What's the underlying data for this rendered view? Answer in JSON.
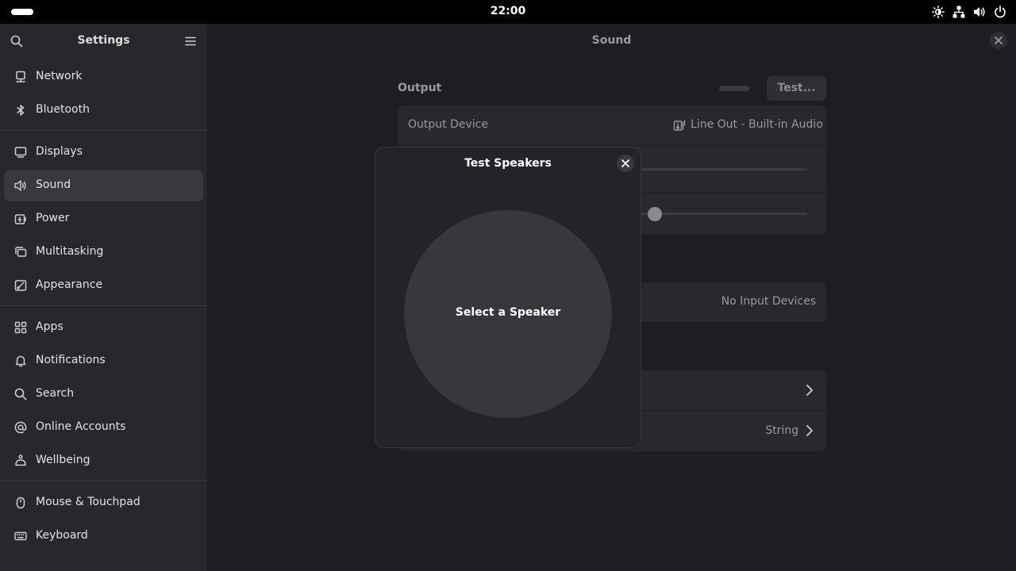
{
  "topbar": {
    "time": "22:00"
  },
  "sidebar": {
    "title": "Settings",
    "groups": [
      [
        {
          "label": "Network",
          "icon": "network-icon"
        },
        {
          "label": "Bluetooth",
          "icon": "bluetooth-icon"
        }
      ],
      [
        {
          "label": "Displays",
          "icon": "display-icon"
        },
        {
          "label": "Sound",
          "icon": "sound-icon",
          "active": true
        },
        {
          "label": "Power",
          "icon": "power-icon"
        },
        {
          "label": "Multitasking",
          "icon": "multitasking-icon"
        },
        {
          "label": "Appearance",
          "icon": "appearance-icon"
        }
      ],
      [
        {
          "label": "Apps",
          "icon": "apps-icon"
        },
        {
          "label": "Notifications",
          "icon": "notifications-icon"
        },
        {
          "label": "Search",
          "icon": "search-icon"
        },
        {
          "label": "Online Accounts",
          "icon": "online-accounts-icon"
        },
        {
          "label": "Wellbeing",
          "icon": "wellbeing-icon"
        }
      ],
      [
        {
          "label": "Mouse & Touchpad",
          "icon": "mouse-icon"
        },
        {
          "label": "Keyboard",
          "icon": "keyboard-icon"
        }
      ]
    ]
  },
  "main": {
    "title": "Sound",
    "output": {
      "section_title": "Output",
      "test_label": "Test...",
      "device_label": "Output Device",
      "device_value": "Line Out - Built-in Audio"
    },
    "input": {
      "no_devices": "No Input Devices"
    },
    "sounds": {
      "alert_value": "String"
    }
  },
  "dialog": {
    "title": "Test Speakers",
    "speaker_button": "Select a Speaker"
  }
}
